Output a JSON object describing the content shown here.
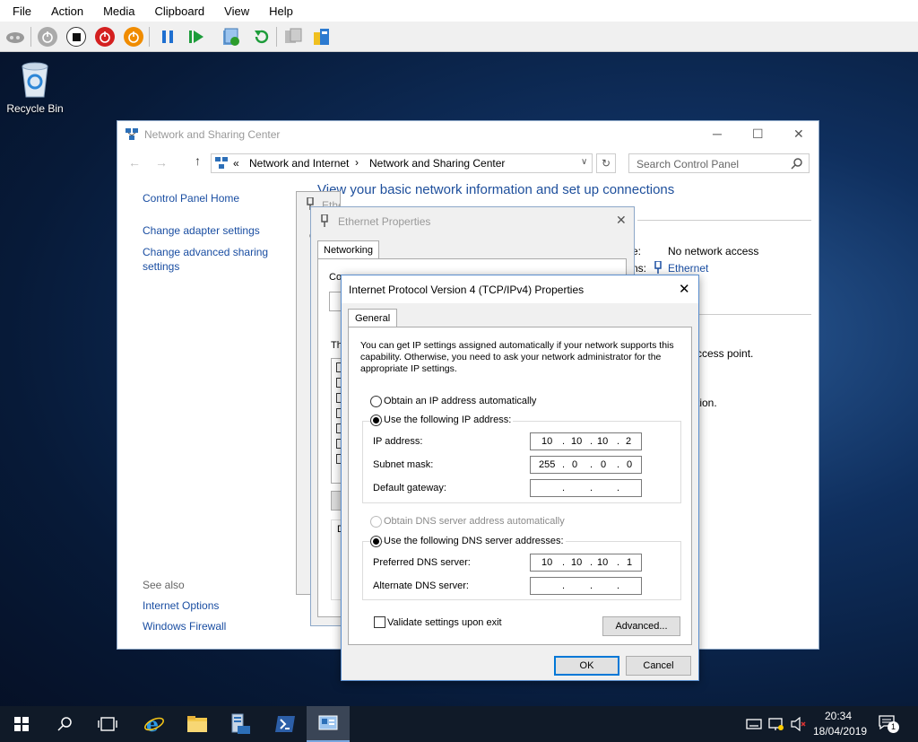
{
  "host_menu": [
    "File",
    "Action",
    "Media",
    "Clipboard",
    "View",
    "Help"
  ],
  "desktop": {
    "recycle_bin": "Recycle Bin"
  },
  "nsc": {
    "title": "Network and Sharing Center",
    "breadcrumb": {
      "chevrons": "«",
      "part1": "Network and Internet",
      "arrow": "›",
      "part2": "Network and Sharing Center"
    },
    "search_placeholder": "Search Control Panel",
    "heading": "View your basic network information and set up connections",
    "left": {
      "home": "Control Panel Home",
      "adapter": "Change adapter settings",
      "sharing": "Change advanced sharing settings",
      "see_also": "See also",
      "internet_options": "Internet Options",
      "firewall": "Windows Firewall"
    },
    "access_label_fragment": "e:",
    "access_value": "No network access",
    "connections_label_fragment": "ns:",
    "connection_link": "Ethernet",
    "fragment1": "ccess point.",
    "fragment2": "tion."
  },
  "eth_status": {
    "title": "Ethernet Status",
    "frag_c": "C"
  },
  "eth_props": {
    "title": "Ethernet Properties",
    "tab": "Networking",
    "frag_connect": "Connect using:",
    "frag_this": "Th",
    "frag_d": "D"
  },
  "ipv4": {
    "title": "Internet Protocol Version 4 (TCP/IPv4) Properties",
    "tab": "General",
    "intro": "You can get IP settings assigned automatically if your network supports this capability. Otherwise, you need to ask your network administrator for the appropriate IP settings.",
    "obtain_ip": "Obtain an IP address automatically",
    "use_ip": "Use the following IP address:",
    "ip_label": "IP address:",
    "ip_value": [
      "10",
      "10",
      "10",
      "2"
    ],
    "mask_label": "Subnet mask:",
    "mask_value": [
      "255",
      "0",
      "0",
      "0"
    ],
    "gateway_label": "Default gateway:",
    "obtain_dns": "Obtain DNS server address automatically",
    "use_dns": "Use the following DNS server addresses:",
    "pref_dns_label": "Preferred DNS server:",
    "pref_dns_value": [
      "10",
      "10",
      "10",
      "1"
    ],
    "alt_dns_label": "Alternate DNS server:",
    "validate": "Validate settings upon exit",
    "advanced": "Advanced...",
    "ok": "OK",
    "cancel": "Cancel"
  },
  "taskbar": {
    "time": "20:34",
    "date": "18/04/2019",
    "notifications": "1"
  }
}
